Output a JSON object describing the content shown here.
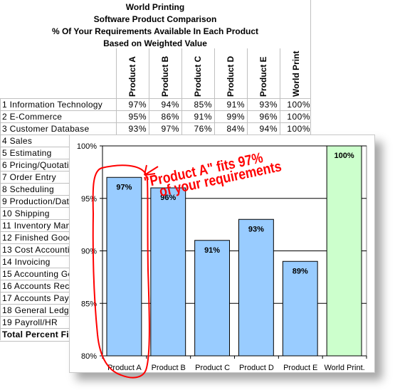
{
  "sheet": {
    "titles": [
      "World Printing",
      "Software Product Comparison",
      "% Of Your Requirements Available In Each Product",
      "Based on Weighted Value"
    ],
    "columns": [
      "Product A",
      "Product B",
      "Product C",
      "Product D",
      "Product E",
      "World Print"
    ],
    "rows": [
      {
        "label": "1  Information Technology",
        "values": [
          "97%",
          "94%",
          "85%",
          "91%",
          "93%",
          "100%"
        ]
      },
      {
        "label": "2  E-Commerce",
        "values": [
          "95%",
          "86%",
          "91%",
          "99%",
          "96%",
          "100%"
        ]
      },
      {
        "label": "3  Customer Database",
        "values": [
          "93%",
          "97%",
          "76%",
          "84%",
          "94%",
          "100%"
        ]
      },
      {
        "label": "4  Sales"
      },
      {
        "label": "5  Estimating"
      },
      {
        "label": "6  Pricing/Quotati"
      },
      {
        "label": "7  Order Entry"
      },
      {
        "label": "8  Scheduling"
      },
      {
        "label": "9  Production/Dat"
      },
      {
        "label": "10 Shipping"
      },
      {
        "label": "11 Inventory Mana"
      },
      {
        "label": "12 Finished Gooc"
      },
      {
        "label": "13 Cost Accountin"
      },
      {
        "label": "14 Invoicing"
      },
      {
        "label": "15 Accounting Ge"
      },
      {
        "label": "16 Accounts Rece"
      },
      {
        "label": "17 Accounts Paya"
      },
      {
        "label": "18 General Ledge"
      },
      {
        "label": "19 Payroll/HR"
      }
    ],
    "total_label": "Total Percent Fit"
  },
  "annotation": {
    "line1": "\"Product A\" fits 97%",
    "line2": "of your requirements",
    "color": "#ff0000"
  },
  "chart_data": {
    "type": "bar",
    "categories": [
      "Product A",
      "Product B",
      "Product C",
      "Product D",
      "Product E",
      "World Print."
    ],
    "values": [
      97,
      96,
      91,
      93,
      89,
      100
    ],
    "data_labels": [
      "97%",
      "96%",
      "91%",
      "93%",
      "89%",
      "100%"
    ],
    "ylim": [
      80,
      100
    ],
    "yticks": [
      "80%",
      "85%",
      "90%",
      "95%",
      "100%"
    ],
    "grid": true,
    "colors": {
      "products": "#99ccff",
      "world_print": "#ccffcc"
    }
  }
}
